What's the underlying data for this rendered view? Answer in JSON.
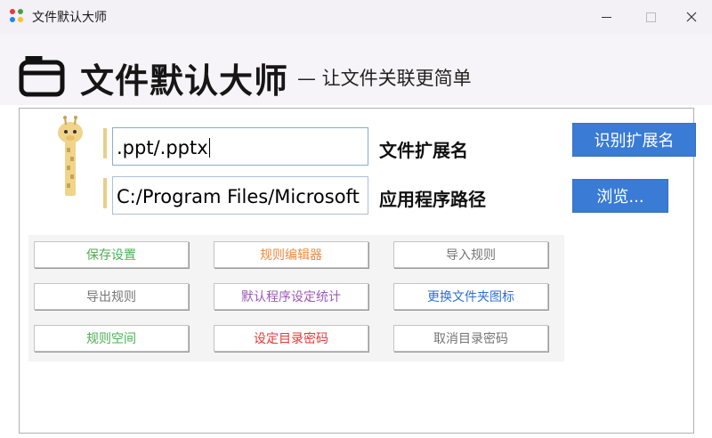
{
  "window": {
    "title": "文件默认大师",
    "controls": {
      "minimize": "—",
      "close": "✕"
    }
  },
  "header": {
    "app_name": "文件默认大师",
    "slogan": "— 让文件关联更简单"
  },
  "form": {
    "extension_value": ".ppt/.pptx",
    "extension_label": "文件扩展名",
    "path_value": "C:/Program Files/Microsoft",
    "path_label": "应用程序路径",
    "identify_button": "识别扩展名",
    "browse_button": "浏览..."
  },
  "actions": [
    {
      "label": "保存设置",
      "color": "#4caf50"
    },
    {
      "label": "规则编辑器",
      "color": "#f08a3c"
    },
    {
      "label": "导入规则",
      "color": "#757575"
    },
    {
      "label": "导出规则",
      "color": "#757575"
    },
    {
      "label": "默认程序设定统计",
      "color": "#9c59b6"
    },
    {
      "label": "更换文件夹图标",
      "color": "#2f6fd1"
    },
    {
      "label": "规则空间",
      "color": "#4caf50"
    },
    {
      "label": "设定目录密码",
      "color": "#e53935"
    },
    {
      "label": "取消目录密码",
      "color": "#757575"
    }
  ],
  "colors": {
    "accent_blue": "#3a7bd5",
    "label_bar": "#e9cf87"
  }
}
